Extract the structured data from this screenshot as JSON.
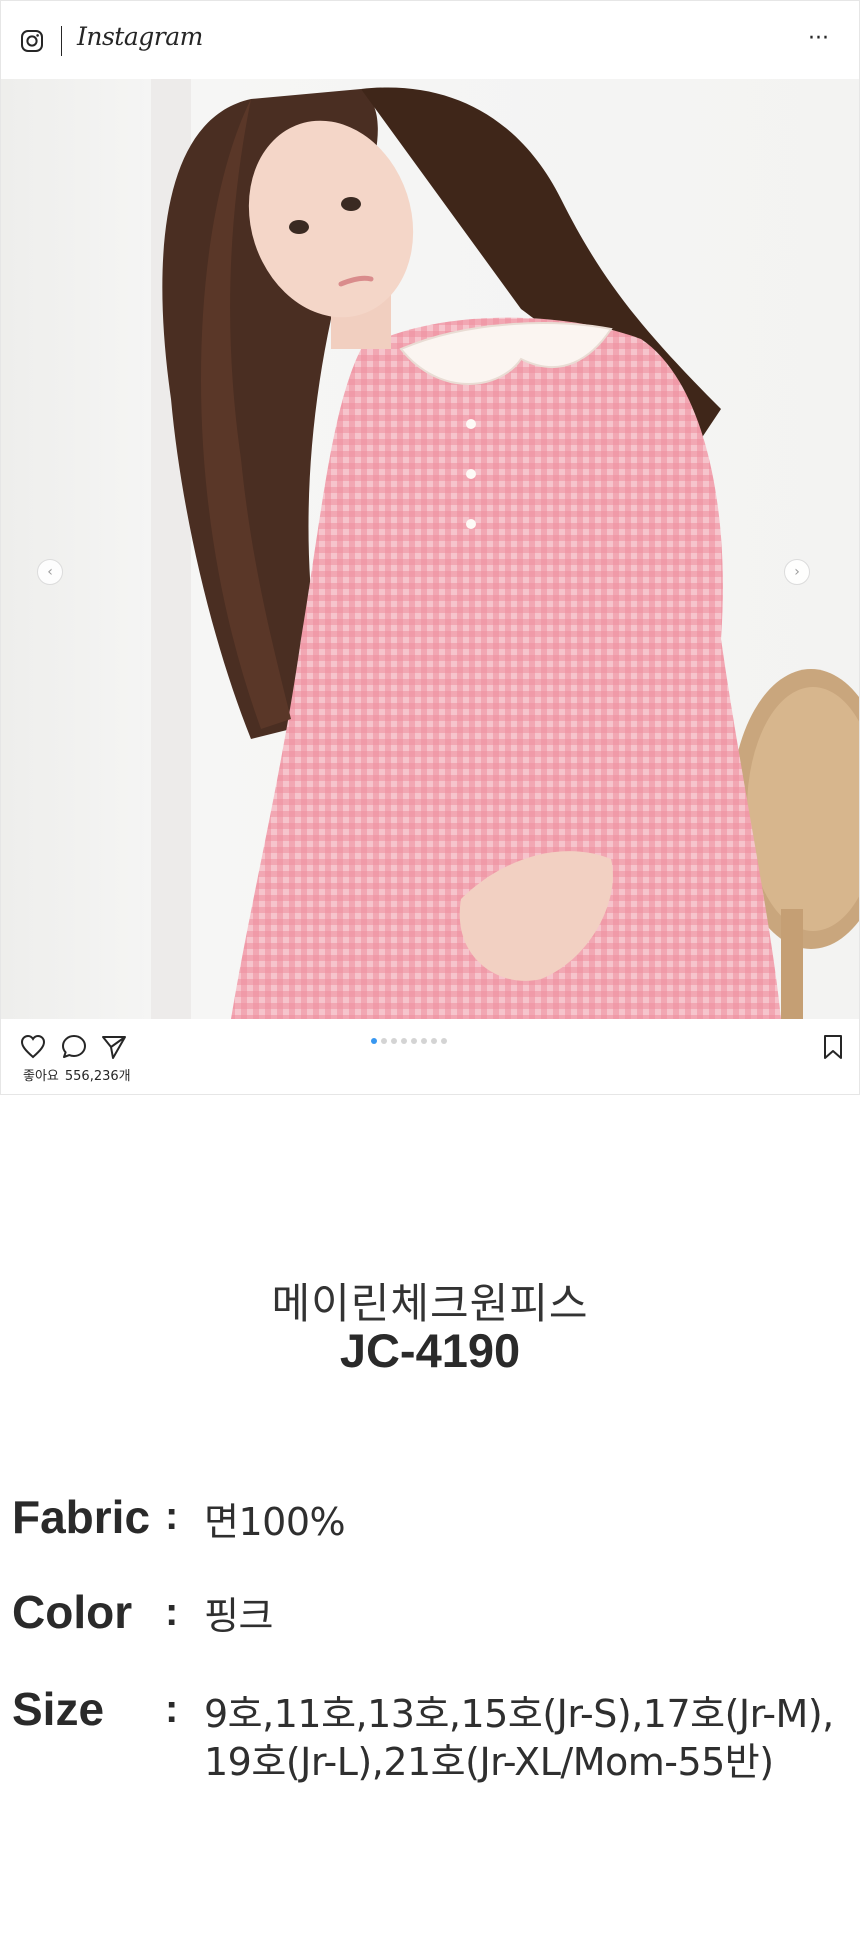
{
  "instagram": {
    "wordmark": "Instagram",
    "more_label": "···",
    "likes_label": "좋아요",
    "likes_count": "556,236개",
    "carousel": {
      "total": 8,
      "active_index": 0
    },
    "colors": {
      "accent": "#3897f0",
      "text": "#262626"
    }
  },
  "product": {
    "name": "메이린체크원피스",
    "code": "JC-4190",
    "specs": {
      "fabric": {
        "label": "Fabric",
        "colon": ":",
        "value": "면100%"
      },
      "color": {
        "label": "Color",
        "colon": ":",
        "value": "핑크"
      },
      "size": {
        "label": "Size",
        "colon": ":",
        "value_line1": "9호,11호,13호,15호(Jr-S),17호(Jr-M),",
        "value_line2": "19호(Jr-L),21호(Jr-XL/Mom-55반)"
      }
    }
  }
}
